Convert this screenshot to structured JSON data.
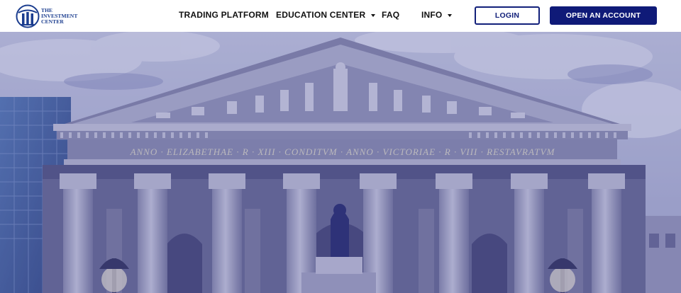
{
  "brand": {
    "logo_line1": "THE",
    "logo_line2": "INVESTMENT",
    "logo_line3": "CENTER",
    "color": "#1b3d8f"
  },
  "nav": {
    "trading_platform": "TRADING PLATFORM",
    "education_center": "EDUCATION CENTER",
    "faq": "FAQ",
    "info": "INFO"
  },
  "buttons": {
    "login": "LOGIN",
    "open_account": "OPEN AN ACCOUNT",
    "primary_color": "#0f1a78"
  },
  "hero": {
    "inscription": "ANNO · ELIZABETHAE · R · XIII · CONDITVM · ANNO · VICTORIAE · R · VIII · RESTAVRATVM",
    "overlay_color": "#2b2f8a"
  }
}
